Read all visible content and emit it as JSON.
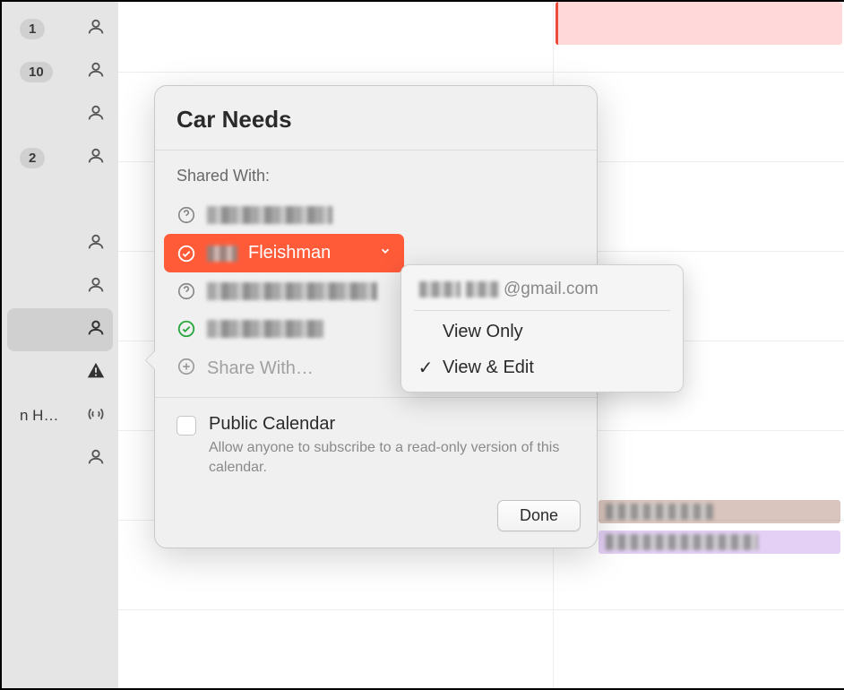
{
  "sidebar": {
    "rows": [
      {
        "badge": "1",
        "icon": "person"
      },
      {
        "badge": "10",
        "icon": "person"
      },
      {
        "badge": "",
        "icon": "person"
      },
      {
        "badge": "2",
        "icon": "person"
      },
      {
        "badge": "",
        "icon": "none"
      },
      {
        "badge": "",
        "icon": "person"
      },
      {
        "badge": "",
        "icon": "person"
      },
      {
        "badge": "",
        "icon": "person",
        "selected": true
      },
      {
        "badge": "",
        "icon": "warning"
      },
      {
        "label": "n H…",
        "icon": "broadcast"
      },
      {
        "badge": "",
        "icon": "person"
      }
    ]
  },
  "popover": {
    "title": "Car Needs",
    "shared_with_label": "Shared With:",
    "sharees": [
      {
        "status": "pending",
        "name_hidden": true
      },
      {
        "status": "accepted",
        "name": "Fleishman",
        "selected": true
      },
      {
        "status": "pending",
        "name_hidden": true
      },
      {
        "status": "accepted-green",
        "name_hidden": true
      }
    ],
    "share_with_placeholder": "Share With…",
    "public": {
      "label": "Public Calendar",
      "desc": "Allow anyone to subscribe to a read-only version of this calendar.",
      "checked": false
    },
    "done_label": "Done"
  },
  "context_menu": {
    "email_suffix": "@gmail.com",
    "items": [
      {
        "label": "View Only",
        "checked": false
      },
      {
        "label": "View & Edit",
        "checked": true
      }
    ]
  },
  "colors": {
    "accent_orange": "#ff5b39",
    "accepted_green": "#2aa83f"
  }
}
